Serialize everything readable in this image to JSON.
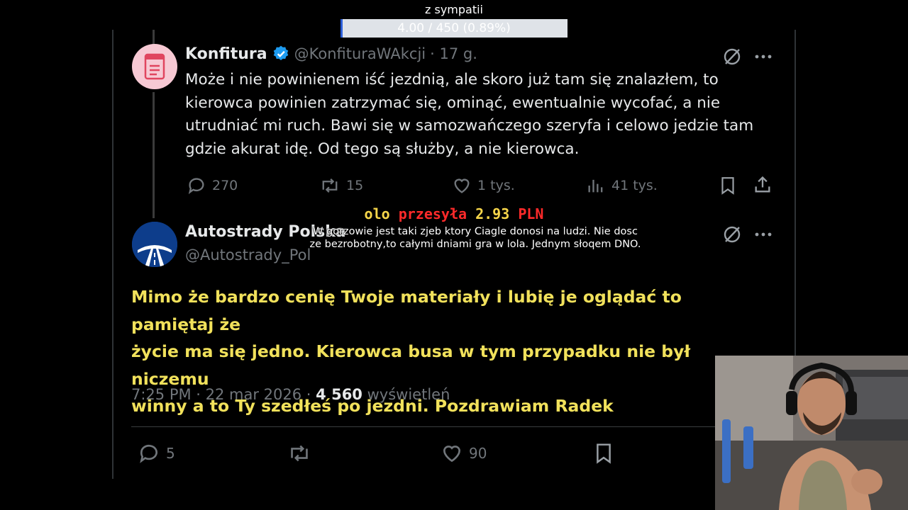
{
  "overlay": {
    "goal_title": "z sympatii",
    "goal_progress_label": "4.00 / 450 (0.89%)",
    "goal_fraction": 0.0089,
    "donation": {
      "user": "olo",
      "verb": "przesyła",
      "amount": "2.93",
      "currency": "PLN",
      "message_line1": "W gorzowie jest taki zjeb ktory Ciagle donosi na ludzi. Nie dosc",
      "message_line2": "ze bezrobotny,to całymi dniami gra w lola. Jednym słoqem DNO."
    }
  },
  "tweet1": {
    "name": "Konfitura",
    "handle": "@KonfituraWAkcji",
    "time": "· 17 g.",
    "lines": [
      "Może i nie powinienem iść jezdnią, ale skoro już tam się znalazłem, to",
      "kierowca powinien zatrzymać się, ominąć, ewentualnie wycofać, a nie",
      "utrudniać mi ruch. Bawi się w samozwańczego szeryfa i celowo jedzie tam",
      "gdzie akurat idę. Od tego są służby, a nie kierowca."
    ],
    "replies": "270",
    "reposts": "15",
    "likes": "1 tys.",
    "views": "41 tys."
  },
  "tweet2": {
    "name": "Autostrady Polska",
    "handle": "@Autostrady_Pol",
    "lines": [
      "Mimo że bardzo cenię Twoje materiały i lubię je oglądać to pamiętaj że",
      "życie ma się jedno. Kierowca busa w tym przypadku nie był niczemu",
      "winny a to Ty szedłeś po jezdni. Pozdrawiam Radek"
    ],
    "timestamp": "7:25 PM · 22 mar 2026 ·",
    "views_count": "4 560",
    "views_label": "wyświetleń",
    "replies": "5",
    "likes": "90"
  },
  "colors": {
    "accent": "#1d9bf0",
    "highlight_text": "#f1e15b",
    "muted": "#71767b"
  }
}
